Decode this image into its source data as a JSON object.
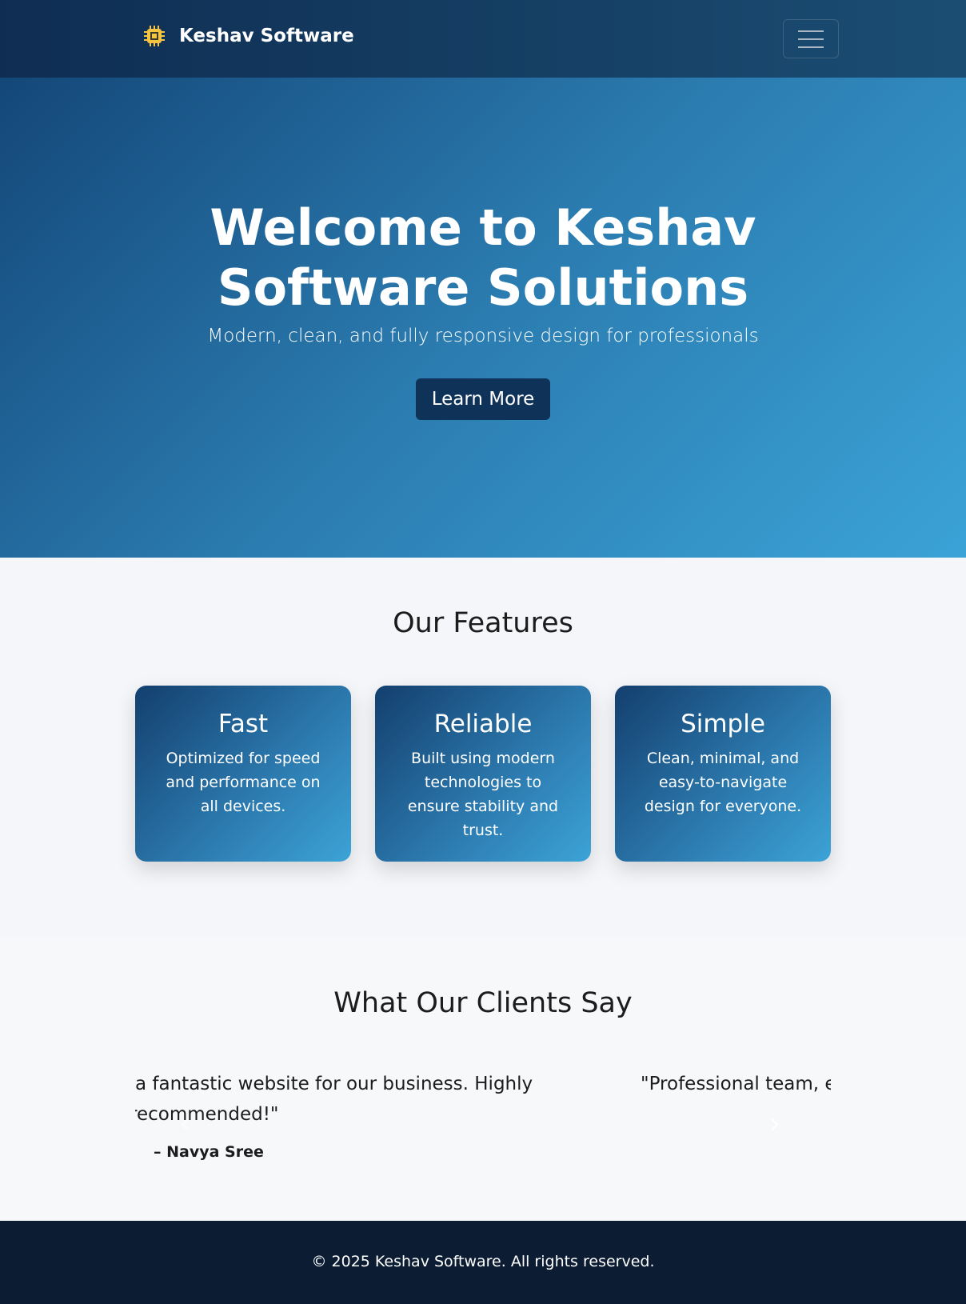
{
  "nav": {
    "brand": "Keshav Software",
    "logo_icon": "cpu-chip-icon",
    "menu_icon": "hamburger-icon"
  },
  "hero": {
    "title": "Welcome to Keshav Software Solutions",
    "subtitle": "Modern, clean, and fully responsive design for professionals",
    "button": "Learn More"
  },
  "features": {
    "title": "Our Features",
    "cards": [
      {
        "title": "Fast",
        "text": "Optimized for speed and performance on all devices."
      },
      {
        "title": "Reliable",
        "text": "Built using modern technologies to ensure stability and trust."
      },
      {
        "title": "Simple",
        "text": "Clean, minimal, and easy-to-navigate design for everyone."
      }
    ]
  },
  "testimonials": {
    "title": "What Our Clients Say",
    "slides": [
      {
        "line1": "a fantastic website for our business. Highly",
        "line2": "recommended!\"",
        "author": "– Navya Sree"
      },
      {
        "line1": "\"Professional team, ex"
      }
    ]
  },
  "footer": {
    "text": "© 2025 Keshav Software. All rights reserved."
  },
  "colors": {
    "nav": "#0f2d52",
    "hero_start": "#144779",
    "hero_end": "#3ba3d7",
    "button": "#0f3259",
    "footer": "#0b1c33",
    "logo": "#f5c542"
  }
}
